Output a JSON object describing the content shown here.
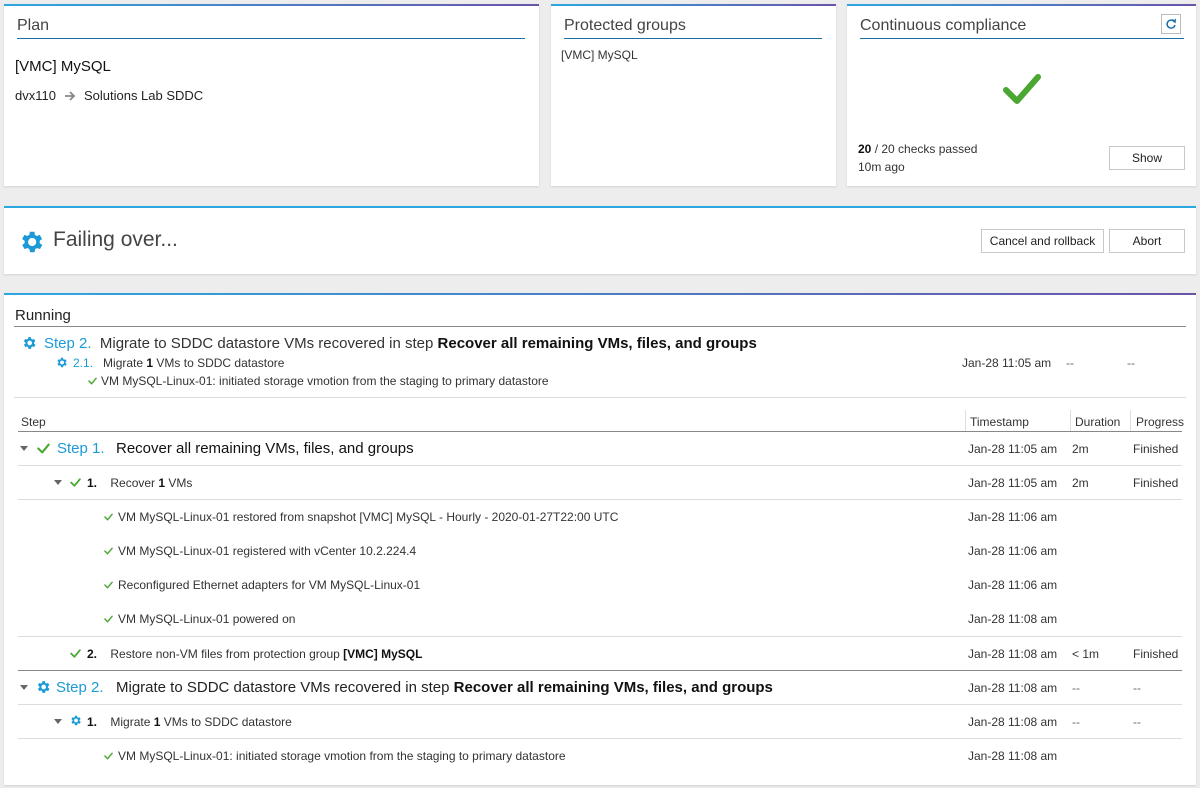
{
  "plan": {
    "title": "Plan",
    "name": "[VMC] MySQL",
    "source": "dvx110",
    "target": "Solutions Lab SDDC"
  },
  "protected_groups": {
    "title": "Protected groups",
    "group": "[VMC] MySQL"
  },
  "compliance": {
    "title": "Continuous compliance",
    "passed": "20",
    "checks_text": " / 20 checks passed",
    "ago": "10m ago",
    "show_label": "Show"
  },
  "status": {
    "title": "Failing over...",
    "cancel_label": "Cancel and rollback",
    "abort_label": "Abort"
  },
  "running": {
    "title": "Running",
    "step_num": "Step 2.",
    "step_text": "Migrate to SDDC datastore VMs recovered in step ",
    "step_ref": "Recover all remaining VMs, files, and groups",
    "sub_num": "2.1.",
    "sub_pre": "Migrate ",
    "sub_count": "1",
    "sub_post": " VMs to SDDC datastore",
    "sub_timestamp": "Jan-28 11:05 am",
    "sub_duration": "--",
    "sub_progress": "--",
    "detail": "VM MySQL-Linux-01: initiated storage vmotion from the staging to primary datastore"
  },
  "table": {
    "headers": {
      "step": "Step",
      "timestamp": "Timestamp",
      "duration": "Duration",
      "progress": "Progress"
    },
    "step1": {
      "num": "Step 1.",
      "title": "Recover all remaining VMs, files, and groups",
      "timestamp": "Jan-28 11:05 am",
      "duration": "2m",
      "progress": "Finished"
    },
    "step1_1": {
      "num": "1.",
      "pre": "Recover ",
      "count": "1",
      "post": " VMs",
      "timestamp": "Jan-28 11:05 am",
      "duration": "2m",
      "progress": "Finished"
    },
    "events": [
      {
        "text": "VM MySQL-Linux-01 restored from snapshot [VMC] MySQL - Hourly - 2020-01-27T22:00 UTC",
        "timestamp": "Jan-28 11:06 am"
      },
      {
        "text": "VM MySQL-Linux-01 registered with vCenter 10.2.224.4",
        "timestamp": "Jan-28 11:06 am"
      },
      {
        "text": "Reconfigured Ethernet adapters for VM MySQL-Linux-01",
        "timestamp": "Jan-28 11:06 am"
      },
      {
        "text": "VM MySQL-Linux-01 powered on",
        "timestamp": "Jan-28 11:08 am"
      }
    ],
    "step1_2": {
      "num": "2.",
      "pre": "Restore non-VM files from protection group ",
      "group": "[VMC] MySQL",
      "timestamp": "Jan-28 11:08 am",
      "duration": "< 1m",
      "progress": "Finished"
    },
    "step2": {
      "num": "Step 2.",
      "pre": "Migrate to SDDC datastore VMs recovered in step ",
      "ref": "Recover all remaining VMs, files, and groups",
      "timestamp": "Jan-28 11:08 am",
      "duration": "--",
      "progress": "--"
    },
    "step2_1": {
      "num": "1.",
      "pre": "Migrate ",
      "count": "1",
      "post": " VMs to SDDC datastore",
      "timestamp": "Jan-28 11:08 am",
      "duration": "--",
      "progress": "--"
    },
    "step2_event": {
      "text": "VM MySQL-Linux-01: initiated storage vmotion from the staging to primary datastore",
      "timestamp": "Jan-28 11:08 am"
    }
  }
}
